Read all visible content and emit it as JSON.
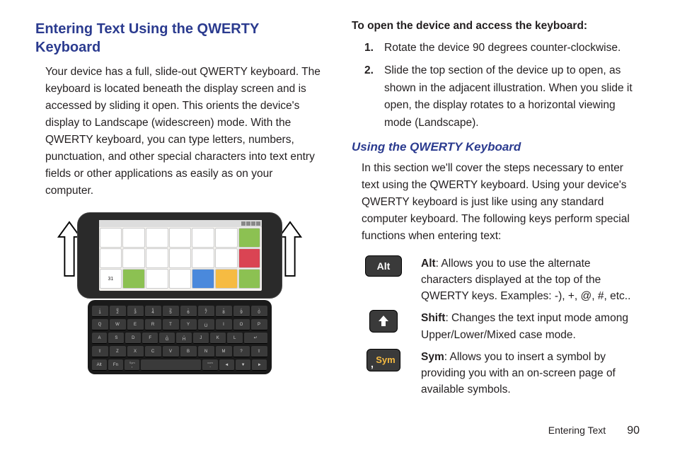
{
  "leftCol": {
    "heading": "Entering Text Using the QWERTY Keyboard",
    "paragraph": "Your device has a full, slide-out QWERTY keyboard. The keyboard is located beneath the display screen and is accessed by sliding it open. This orients the device's display to Landscape (widescreen) mode. With the QWERTY keyboard, you can type letters, numbers, punctuation, and other special characters into text entry fields or other applications as easily as on your computer."
  },
  "rightCol": {
    "openHeading": "To open the device and access the keyboard:",
    "steps": [
      "Rotate the device 90 degrees counter-clockwise.",
      "Slide the top section of the device up to open, as shown in the adjacent illustration. When you slide it open, the display rotates to a horizontal viewing mode (Landscape)."
    ],
    "usingHeading": "Using the QWERTY Keyboard",
    "usingIntro": "In this section we'll cover the steps necessary to enter text using the QWERTY keyboard. Using your device's QWERTY keyboard is just like using any standard computer keyboard. The following keys perform special functions when entering text:",
    "keys": {
      "alt": {
        "label": "Alt",
        "name": "Alt",
        "desc": ": Allows you to use the alternate characters displayed at the top of the QWERTY keys. Examples: -), +, @, #, etc.."
      },
      "shift": {
        "name": "Shift",
        "desc": ": Changes the text input mode among Upper/Lower/Mixed case mode."
      },
      "sym": {
        "label": "Sym",
        "comma": ",",
        "name": "Sym",
        "desc": ": Allows you to insert a symbol by providing you with an on-screen page of available symbols."
      }
    }
  },
  "footer": {
    "section": "Entering Text",
    "page": "90"
  },
  "kb": {
    "r1": [
      [
        "1",
        "!"
      ],
      [
        "2",
        "@"
      ],
      [
        "3",
        "#"
      ],
      [
        "4",
        "$"
      ],
      [
        "5",
        "%"
      ],
      [
        "6",
        "^"
      ],
      [
        "7",
        "&"
      ],
      [
        "8",
        "*"
      ],
      [
        "9",
        "("
      ],
      [
        "0",
        ")"
      ]
    ],
    "r2": [
      [
        "Q",
        ""
      ],
      [
        "W",
        ""
      ],
      [
        "E",
        ""
      ],
      [
        "R",
        ""
      ],
      [
        "T",
        ""
      ],
      [
        "Y",
        ""
      ],
      [
        "U",
        "-"
      ],
      [
        "I",
        ""
      ],
      [
        "O",
        ""
      ],
      [
        "P",
        ""
      ]
    ],
    "r3": [
      [
        "A",
        ""
      ],
      [
        "S",
        ""
      ],
      [
        "D",
        ""
      ],
      [
        "F",
        ""
      ],
      [
        "G",
        "<"
      ],
      [
        "H",
        ">"
      ],
      [
        "J",
        ""
      ],
      [
        "K",
        ""
      ],
      [
        "L",
        ""
      ],
      [
        "",
        "Enter"
      ]
    ],
    "r4": [
      [
        "⇧",
        ""
      ],
      [
        "Z",
        ""
      ],
      [
        "X",
        ""
      ],
      [
        "C",
        ""
      ],
      [
        "V",
        ""
      ],
      [
        "B",
        ""
      ],
      [
        "N",
        ""
      ],
      [
        "M",
        ""
      ],
      [
        "?",
        ""
      ],
      [
        "⇧",
        ""
      ]
    ],
    "r5": [
      [
        "Alt",
        ""
      ],
      [
        "Fn",
        ""
      ],
      [
        ",",
        "Sym"
      ],
      [
        "",
        "space"
      ],
      [
        ".",
        "com"
      ],
      [
        "◄",
        ""
      ],
      [
        "▼",
        ""
      ],
      [
        "►",
        ""
      ]
    ]
  }
}
